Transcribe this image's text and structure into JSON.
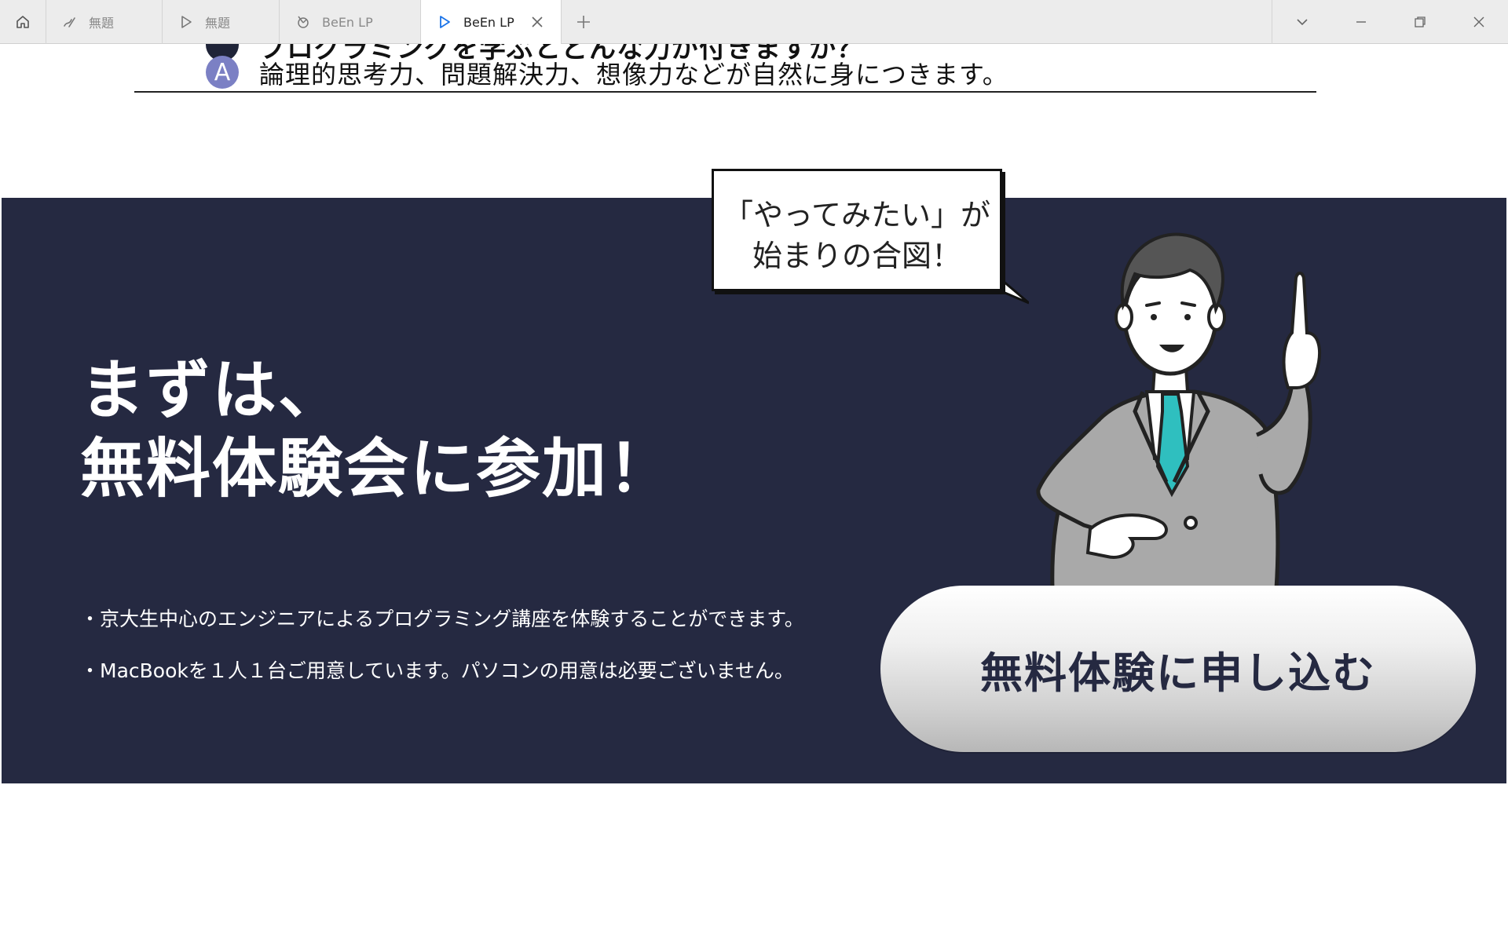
{
  "tabs": [
    {
      "title": "無題",
      "icon": "pen-icon"
    },
    {
      "title": "無題",
      "icon": "play-icon"
    },
    {
      "title": "BeEn LP",
      "icon": "compass-icon"
    },
    {
      "title": "BeEn LP",
      "icon": "play-icon",
      "active": true
    }
  ],
  "faq": {
    "question_partial": "プログラミングを学ぶとどんな力が付きますか？",
    "answer_badge": "A",
    "answer": "論理的思考力、問題解決力、想像力などが自然に身につきます。"
  },
  "cta": {
    "speech_bubble_line1": "「やってみたい」が",
    "speech_bubble_line2": "始まりの合図！",
    "headline_line1": "まずは、",
    "headline_line2": "無料体験会に参加！",
    "bullets": [
      "・京大生中心のエンジニアによるプログラミング講座を体験することができます。",
      "・MacBookを１人１台ご用意しています。パソコンの用意は必要ございません。"
    ],
    "button_label": "無料体験に申し込む"
  },
  "colors": {
    "band": "#252941",
    "answer_badge": "#7b80c4",
    "tie": "#2fbfbf",
    "active_tab_icon": "#1a73e8"
  }
}
